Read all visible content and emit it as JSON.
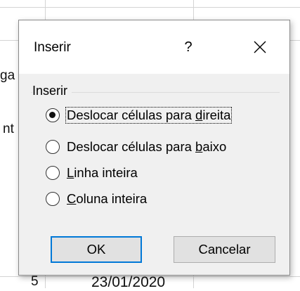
{
  "sheet": {
    "fragments": {
      "left_row1": "ga",
      "left_row2": "nt",
      "bottom_left": "5",
      "bottom_date": "23/01/2020"
    }
  },
  "dialog": {
    "title": "Inserir",
    "help_label": "?",
    "close_icon": "close-icon",
    "group_label": "Inserir",
    "options": [
      {
        "pre": "Deslocar células para ",
        "acc": "d",
        "post": "ireita",
        "checked": true
      },
      {
        "pre": "Deslocar células para ",
        "acc": "b",
        "post": "aixo",
        "checked": false
      },
      {
        "pre": "",
        "acc": "L",
        "post": "inha inteira",
        "checked": false
      },
      {
        "pre": "",
        "acc": "C",
        "post": "oluna inteira",
        "checked": false
      }
    ],
    "ok_label": "OK",
    "cancel_label": "Cancelar",
    "accent_color": "#0078d7"
  }
}
